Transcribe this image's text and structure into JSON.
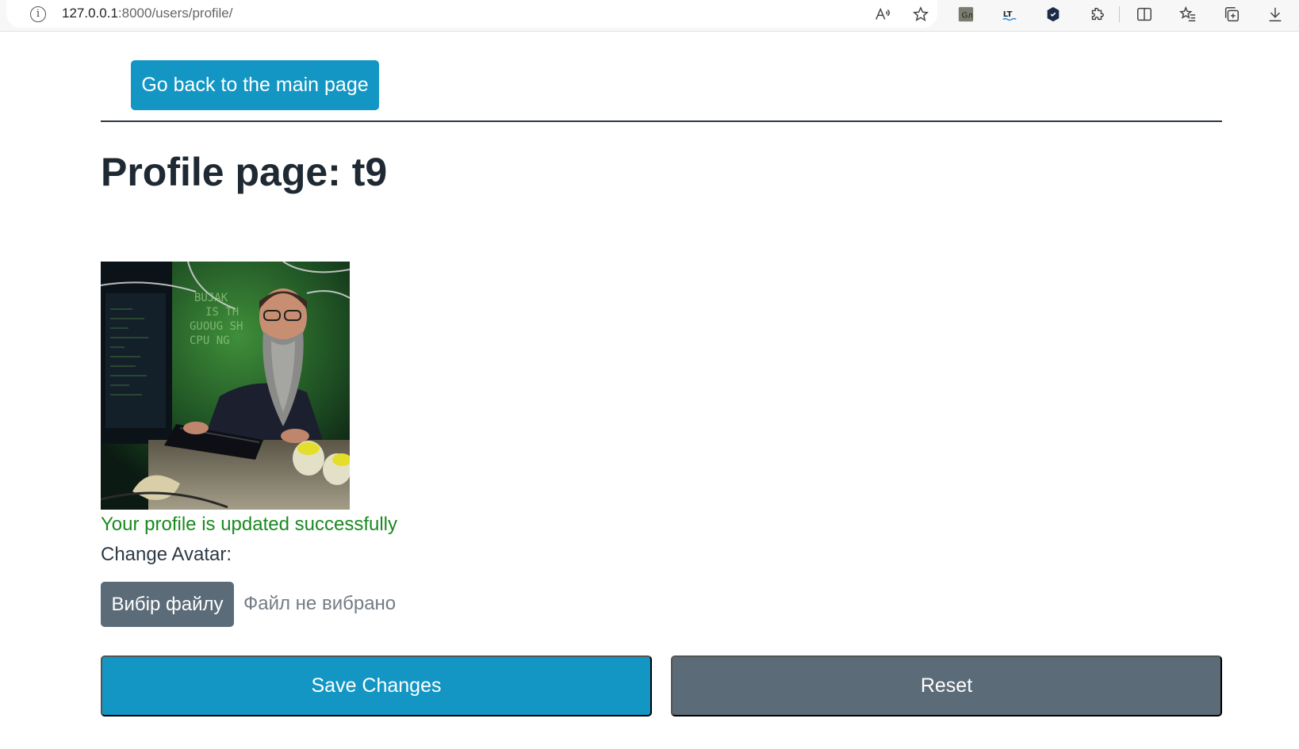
{
  "browser": {
    "url_host": "127.0.0.1",
    "url_rest": ":8000/users/profile/",
    "icons": [
      "info-icon",
      "read-aloud-icon",
      "favorite-star-icon",
      "extension-translate-icon",
      "extension-languagetool-icon",
      "extension-shield-icon",
      "extensions-puzzle-icon",
      "split-screen-icon",
      "favorites-list-icon",
      "collections-icon",
      "downloads-icon"
    ]
  },
  "page": {
    "back_button": "Go back to the main page",
    "title": "Profile page: t9",
    "success_message": "Your profile is updated successfully",
    "change_avatar_label": "Change Avatar:",
    "file_button": "Вибір файлу",
    "file_status": "Файл не вибрано",
    "save_button": "Save Changes",
    "reset_button": "Reset"
  },
  "colors": {
    "primary": "#1396c3",
    "secondary": "#5b6b78",
    "success": "#198a1f"
  }
}
